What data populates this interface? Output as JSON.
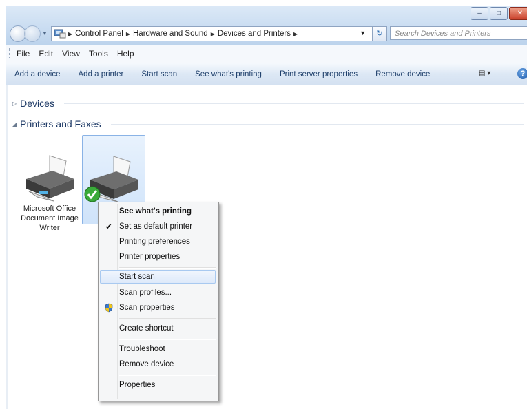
{
  "titlebar": {
    "minimize": "–",
    "maximize": "□",
    "close": "✕"
  },
  "address": {
    "crumbs": [
      "Control Panel",
      "Hardware and Sound",
      "Devices and Printers"
    ],
    "separator": "▶",
    "dropdown": "▼",
    "refresh": "↻"
  },
  "search": {
    "placeholder": "Search Devices and Printers",
    "icon": "⌕"
  },
  "menubar": {
    "items": [
      "File",
      "Edit",
      "View",
      "Tools",
      "Help"
    ]
  },
  "commandbar": {
    "items": [
      "Add a device",
      "Add a printer",
      "Start scan",
      "See what's printing",
      "Print server properties",
      "Remove device"
    ],
    "views_glyph": "▤  ▾",
    "help": "?"
  },
  "groups": {
    "devices": {
      "title": "Devices",
      "arrow": "▷"
    },
    "printers": {
      "title": "Printers and Faxes",
      "arrow": "◢"
    }
  },
  "printers": [
    {
      "label": "Microsoft Office Document Image Writer",
      "selected": false,
      "default": false
    },
    {
      "label": "",
      "selected": true,
      "default": true
    }
  ],
  "context_menu": {
    "items": [
      {
        "label": "See what's printing",
        "bold": true
      },
      {
        "label": "Set as default printer",
        "icon": "✔"
      },
      {
        "label": "Printing preferences"
      },
      {
        "label": "Printer properties"
      },
      {
        "label": "Start scan",
        "hover": true
      },
      {
        "label": "Scan profiles..."
      },
      {
        "label": "Scan properties",
        "icon": "shield-icon"
      },
      {
        "label": "Create shortcut"
      },
      {
        "label": "Troubleshoot"
      },
      {
        "label": "Remove device"
      },
      {
        "label": "Properties"
      }
    ]
  }
}
